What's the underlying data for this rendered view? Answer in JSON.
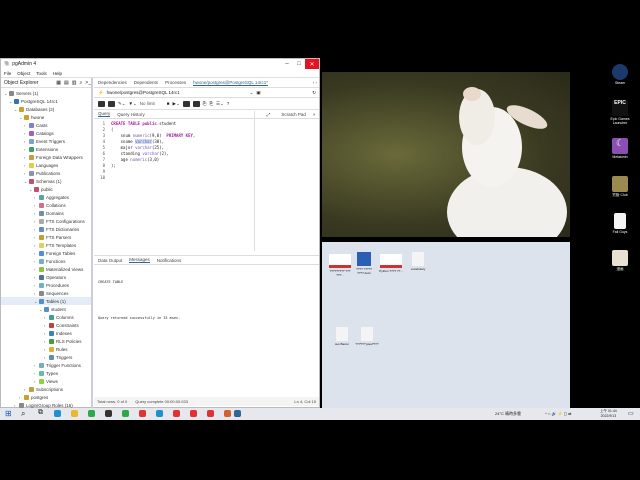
{
  "window": {
    "title": "pgAdmin 4",
    "menu": [
      "File",
      "Object",
      "Tools",
      "Help"
    ]
  },
  "explorer": {
    "title": "Object Explorer",
    "tree": [
      {
        "label": "Servers (1)",
        "level": 0,
        "open": true,
        "color": "#888"
      },
      {
        "label": "PostgreSQL 14rc1",
        "level": 1,
        "open": true,
        "color": "#3a6fb0"
      },
      {
        "label": "Databases (2)",
        "level": 2,
        "open": true,
        "color": "#c8a030"
      },
      {
        "label": "hwone",
        "level": 3,
        "open": true,
        "color": "#c8a030"
      },
      {
        "label": "Casts",
        "level": 4,
        "color": "#8080d0"
      },
      {
        "label": "Catalogs",
        "level": 4,
        "color": "#a060c0"
      },
      {
        "label": "Event Triggers",
        "level": 4,
        "color": "#80a0d0"
      },
      {
        "label": "Extensions",
        "level": 4,
        "color": "#40a060"
      },
      {
        "label": "Foreign Data Wrappers",
        "level": 4,
        "color": "#c0a040"
      },
      {
        "label": "Languages",
        "level": 4,
        "color": "#e0d040"
      },
      {
        "label": "Publications",
        "level": 4,
        "color": "#9090b0"
      },
      {
        "label": "Schemas (1)",
        "level": 4,
        "open": true,
        "color": "#c05070"
      },
      {
        "label": "public",
        "level": 5,
        "open": true,
        "color": "#c05070"
      },
      {
        "label": "Aggregates",
        "level": 6,
        "color": "#60a0a0"
      },
      {
        "label": "Collations",
        "level": 6,
        "color": "#d07090"
      },
      {
        "label": "Domains",
        "level": 6,
        "color": "#7090a0"
      },
      {
        "label": "FTS Configurations",
        "level": 6,
        "color": "#aaa"
      },
      {
        "label": "FTS Dictionaries",
        "level": 6,
        "color": "#6090c0"
      },
      {
        "label": "FTS Parsers",
        "level": 6,
        "color": "#c0a030"
      },
      {
        "label": "FTS Templates",
        "level": 6,
        "color": "#e0d060"
      },
      {
        "label": "Foreign Tables",
        "level": 6,
        "color": "#5090d0"
      },
      {
        "label": "Functions",
        "level": 6,
        "color": "#70b0c0"
      },
      {
        "label": "Materialized Views",
        "level": 6,
        "color": "#90c040"
      },
      {
        "label": "Operators",
        "level": 6,
        "color": "#5070a0"
      },
      {
        "label": "Procedures",
        "level": 6,
        "color": "#70b0c0"
      },
      {
        "label": "Sequences",
        "level": 6,
        "color": "#888"
      },
      {
        "label": "Tables (1)",
        "level": 6,
        "open": true,
        "color": "#5090d0"
      },
      {
        "label": "student",
        "level": 7,
        "open": true,
        "color": "#5090d0"
      },
      {
        "label": "Columns",
        "level": 8,
        "color": "#40a090"
      },
      {
        "label": "Constraints",
        "level": 8,
        "color": "#c04040"
      },
      {
        "label": "Indexes",
        "level": 8,
        "color": "#4080c0"
      },
      {
        "label": "RLS Policies",
        "level": 8,
        "color": "#40a040"
      },
      {
        "label": "Rules",
        "level": 8,
        "color": "#e0b030"
      },
      {
        "label": "Triggers",
        "level": 8,
        "color": "#6090b0"
      },
      {
        "label": "Trigger Functions",
        "level": 6,
        "color": "#70b0c0"
      },
      {
        "label": "Types",
        "level": 6,
        "color": "#60c0a0"
      },
      {
        "label": "Views",
        "level": 6,
        "color": "#90d040"
      },
      {
        "label": "Subscriptions",
        "level": 4,
        "color": "#c0a040"
      },
      {
        "label": "postgres",
        "level": 3,
        "color": "#c8a030"
      },
      {
        "label": "Login/Group Roles (16)",
        "level": 2,
        "color": "#888"
      }
    ]
  },
  "main": {
    "tabs": [
      "Dependencies",
      "Dependents",
      "Processes",
      "hwone/postgres@PostgreSQL 14rc1*"
    ],
    "connection": "hwone/postgres@PostgreSQL 14rc1",
    "limit": "No limit",
    "editor_tabs": [
      "Query",
      "Query History"
    ],
    "scratch_pad": "Scratch Pad",
    "code_lines": [
      "1",
      "2",
      "3",
      "4",
      "5",
      "6",
      "7",
      "8",
      "9",
      "10"
    ],
    "output_tabs": [
      "Data Output",
      "Messages",
      "Notifications"
    ],
    "messages": [
      "CREATE TABLE",
      "Query returned successfully in 33 msec."
    ],
    "status": {
      "rows": "Total rows: 0 of 0",
      "complete": "Query complete 00:00:00.033",
      "pos": "Ln 4, Col 15"
    }
  },
  "desktop_icons": [
    "Steam",
    "Epic Games Launcher",
    "Melatonin",
    "究极·Club",
    "Fall Guys",
    "漫画"
  ],
  "folder_files": [
    "????????? ??? ???...",
    "???? ????? ????.docx",
    "Python ???? ??...",
    "vocabulary",
    "sus Bacon",
    "?????? java????"
  ],
  "taskbar": {
    "weather": "24°C 晴時多雲",
    "time": "上午 01:44",
    "date": "2022/9/13"
  }
}
